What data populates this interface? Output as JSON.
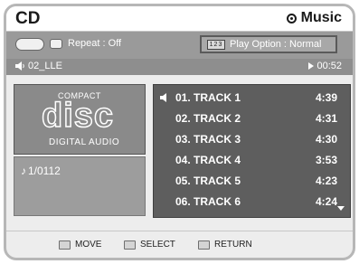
{
  "header": {
    "title": "CD",
    "mode_label": "Music"
  },
  "options": {
    "repeat_label": "Repeat : Off",
    "play_option_label": "Play Option : Normal",
    "play_option_icon_text": "123"
  },
  "status": {
    "now_playing": "02_LLE",
    "elapsed": "00:52"
  },
  "disc_logo": {
    "compact": "COMPACT",
    "disc": "disc",
    "digital": "DIGITAL AUDIO"
  },
  "track_count": "1/0112",
  "tracks": [
    {
      "title": "01. TRACK 1",
      "duration": "4:39"
    },
    {
      "title": "02. TRACK 2",
      "duration": "4:31"
    },
    {
      "title": "03. TRACK 3",
      "duration": "4:30"
    },
    {
      "title": "04. TRACK 4",
      "duration": "3:53"
    },
    {
      "title": "05. TRACK 5",
      "duration": "4:23"
    },
    {
      "title": "06. TRACK 6",
      "duration": "4:24"
    }
  ],
  "footer": {
    "move": "MOVE",
    "select": "SELECT",
    "return": "RETURN"
  },
  "icons": {
    "mode": "disc-mode-icon",
    "speaker": "speaker-icon",
    "play": "play-icon",
    "note": "music-note-icon",
    "scroll": "scroll-down-icon"
  }
}
